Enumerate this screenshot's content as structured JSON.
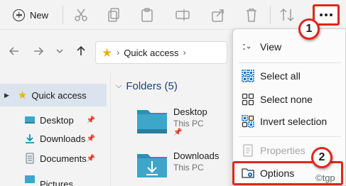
{
  "toolbar": {
    "new_label": "New"
  },
  "address": {
    "location": "Quick access"
  },
  "nav": {
    "quick_access": "Quick access",
    "items": [
      {
        "label": "Desktop"
      },
      {
        "label": "Downloads"
      },
      {
        "label": "Documents"
      },
      {
        "label": "Pictures"
      }
    ]
  },
  "content": {
    "folders_header": "Folders (5)",
    "folders": [
      {
        "name": "Desktop",
        "location": "This PC"
      },
      {
        "name": "Downloads",
        "location": "This PC"
      }
    ]
  },
  "menu": {
    "view": "View",
    "select_all": "Select all",
    "select_none": "Select none",
    "invert_selection": "Invert selection",
    "properties": "Properties",
    "options": "Options"
  },
  "callouts": {
    "first": "1",
    "second": "2"
  },
  "watermark": "©tgp",
  "colors": {
    "accent": "#0067c0",
    "callout_red": "#e0261d",
    "folder_teal": "#3ea6c9"
  }
}
